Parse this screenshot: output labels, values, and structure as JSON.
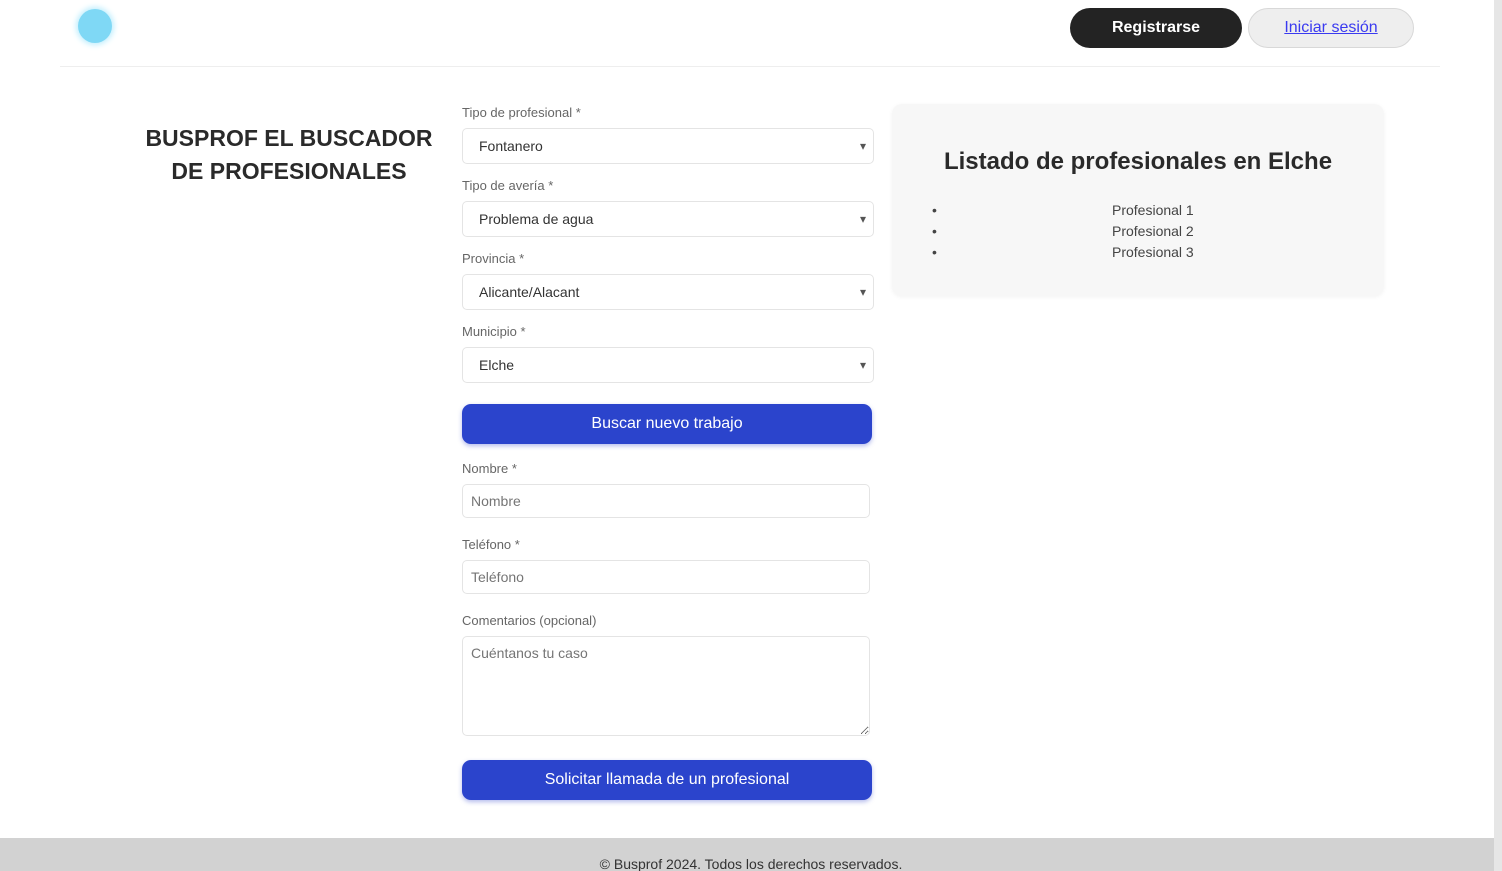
{
  "header": {
    "register_label": "Registrarse",
    "login_label": "Iniciar sesión"
  },
  "main": {
    "title": "BUSPROF EL BUSCADOR DE PROFESIONALES"
  },
  "form": {
    "profession_label": "Tipo de profesional *",
    "profession_value": "Fontanero",
    "problem_label": "Tipo de avería *",
    "problem_value": "Problema de agua",
    "province_label": "Provincia *",
    "province_value": "Alicante/Alacant",
    "municipality_label": "Municipio *",
    "municipality_value": "Elche",
    "search_button": "Buscar nuevo trabajo",
    "name_label": "Nombre *",
    "name_placeholder": "Nombre",
    "phone_label": "Teléfono *",
    "phone_placeholder": "Teléfono",
    "comments_label": "Comentarios (opcional)",
    "comments_placeholder": "Cuéntanos tu caso",
    "submit_button": "Solicitar llamada de un profesional"
  },
  "panel": {
    "title": "Listado de profesionales en Elche",
    "items": [
      {
        "bullet": "•",
        "name": "Profesional 1"
      },
      {
        "bullet": "•",
        "name": "Profesional 2"
      },
      {
        "bullet": "•",
        "name": "Profesional 3"
      }
    ]
  },
  "footer": {
    "text": "© Busprof 2024. Todos los derechos reservados."
  },
  "colors": {
    "primary": "#2b44cc",
    "dark_button": "#232323",
    "logo": "#7fd8f5",
    "footer": "#d2d2d2"
  },
  "icons": {
    "logo": "logo-icon",
    "chevron": "chevron-down-icon"
  }
}
